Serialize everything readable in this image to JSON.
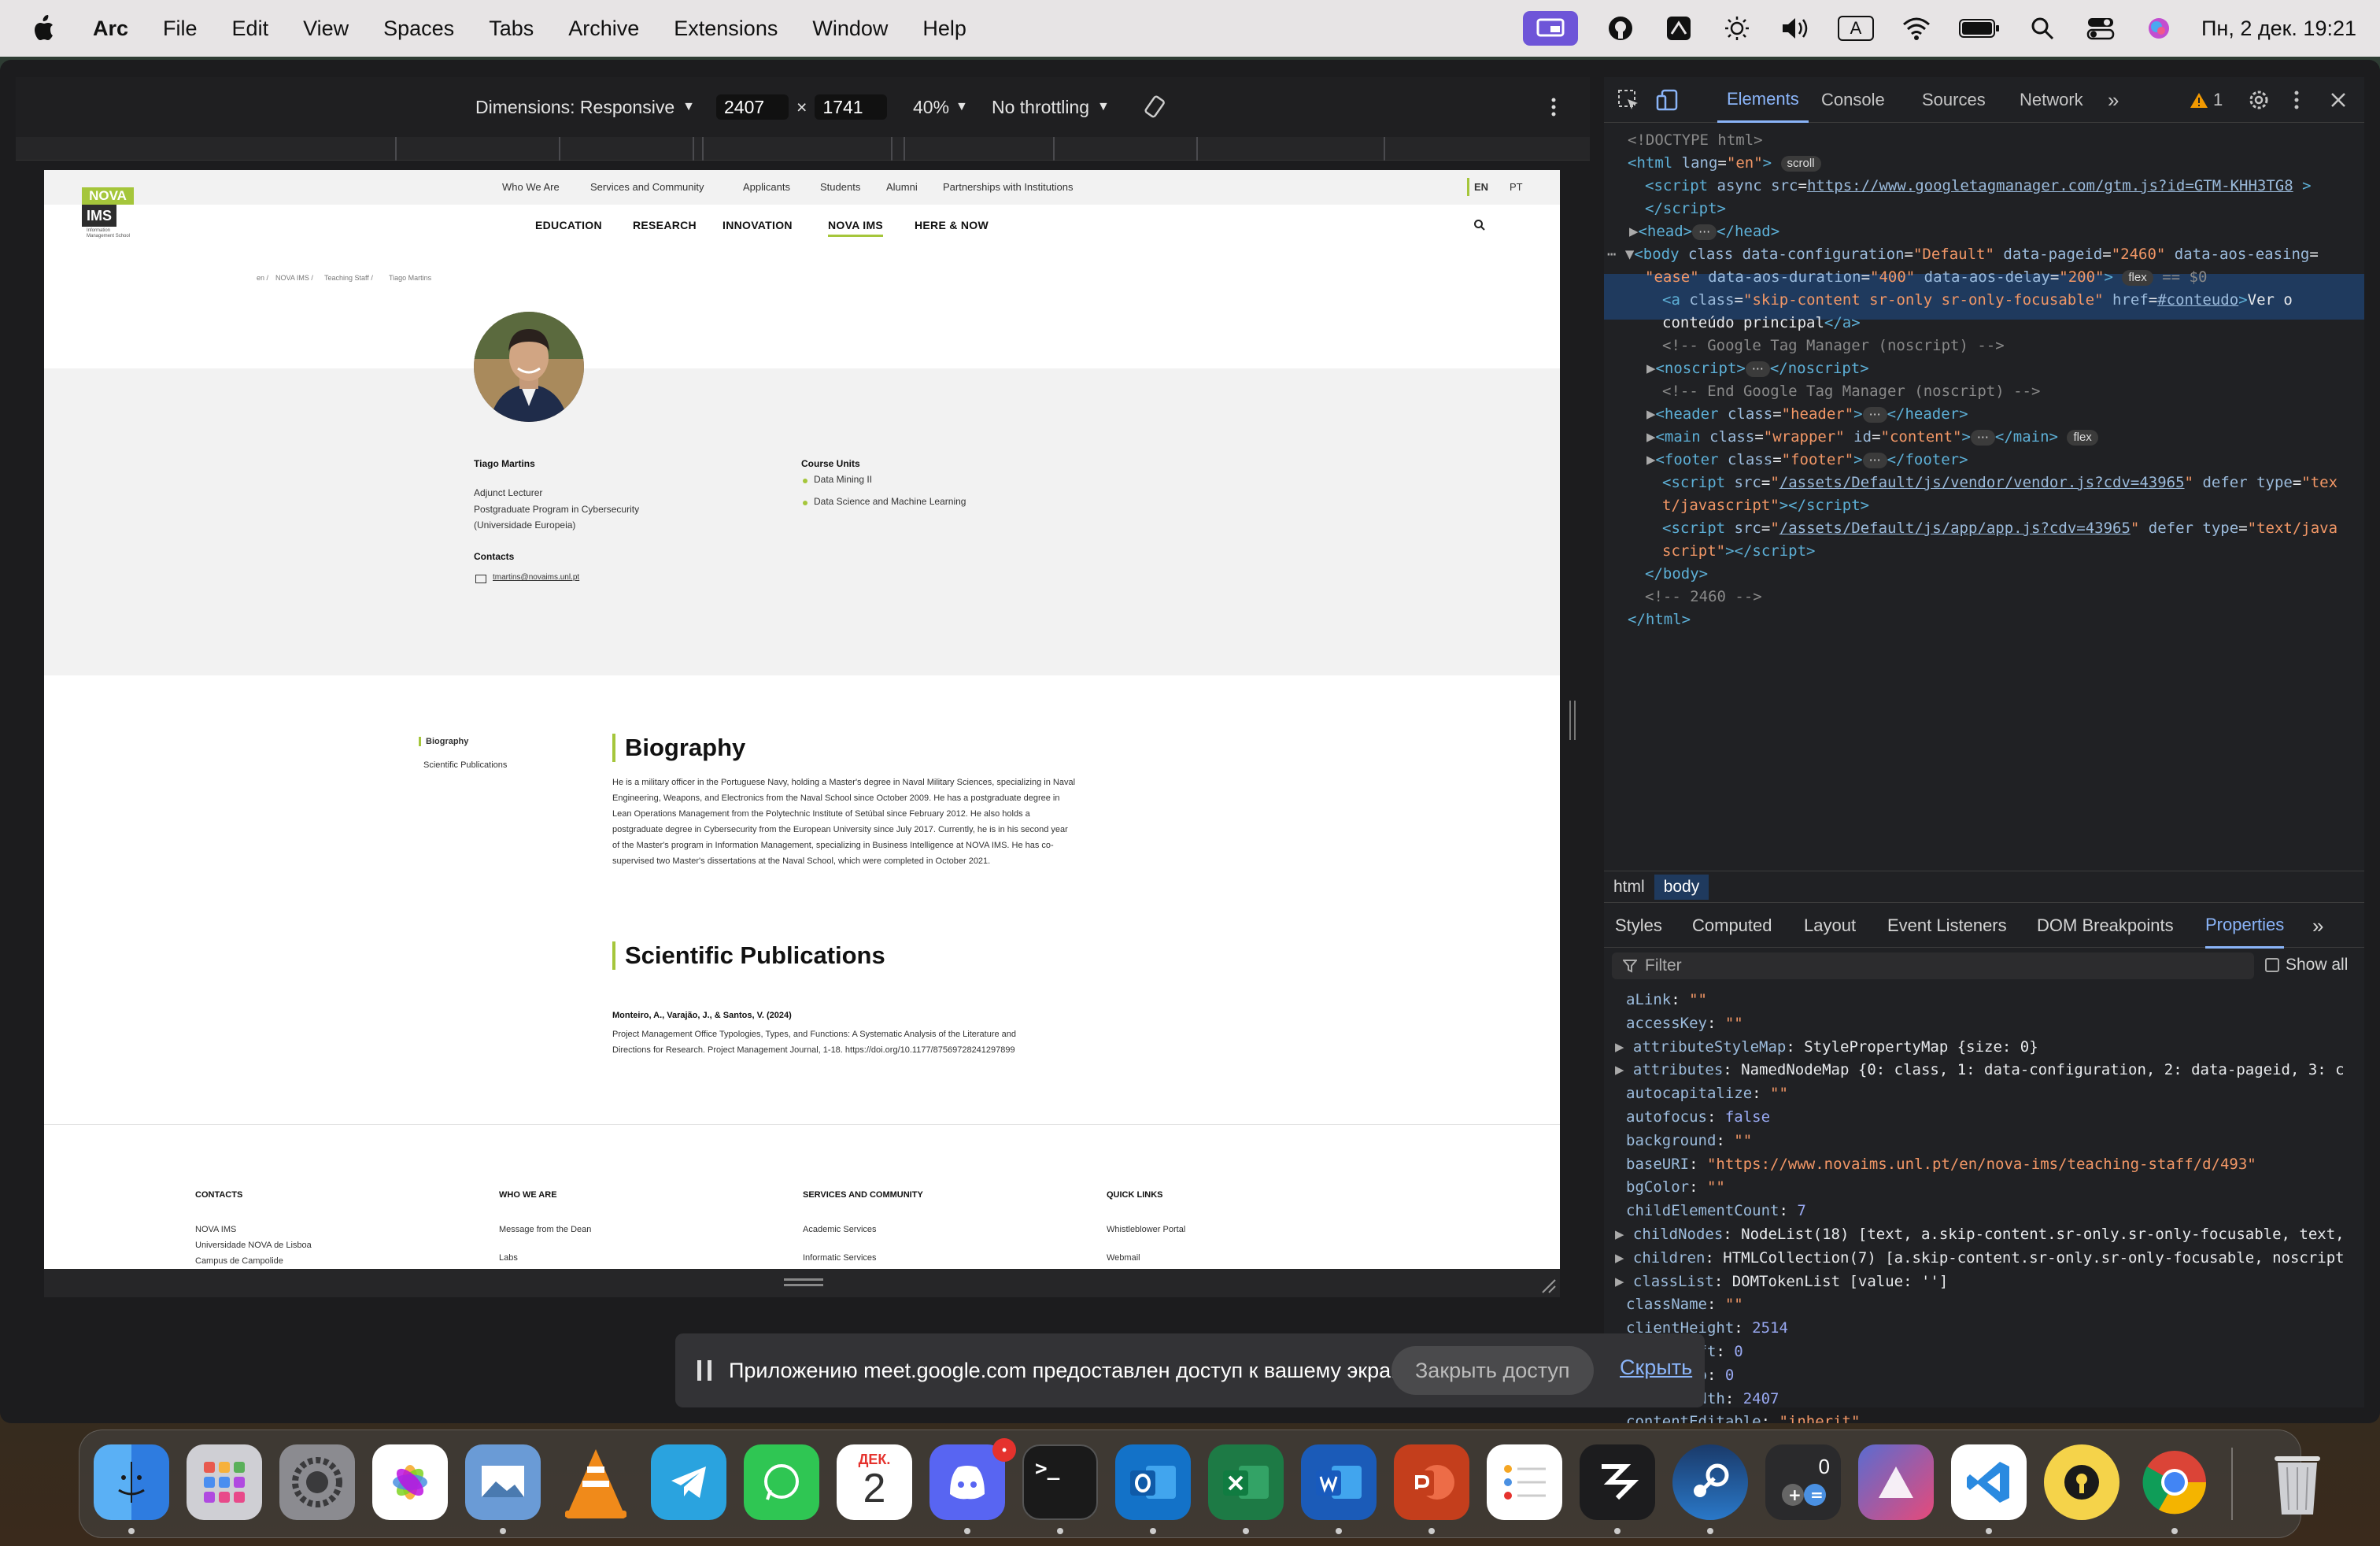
{
  "menubar": {
    "app": "Arc",
    "items": [
      "File",
      "Edit",
      "View",
      "Spaces",
      "Tabs",
      "Archive",
      "Extensions",
      "Window",
      "Help"
    ],
    "clock": "Пн, 2 дек.  19:21",
    "input_indicator": "A",
    "status_icons": [
      "screen-share-icon",
      "github-icon",
      "stage-icon",
      "brightness-icon",
      "volume-icon",
      "keyboard-icon",
      "wifi-icon",
      "battery-icon",
      "search-icon",
      "control-center-icon",
      "siri-icon"
    ]
  },
  "device_toolbar": {
    "dimensions_label": "Dimensions: Responsive",
    "width": "2407",
    "times": "×",
    "height": "1741",
    "zoom": "40%",
    "throttling": "No throttling"
  },
  "site": {
    "logo": {
      "nova": "NOVA",
      "ims": "IMS",
      "sub": "Information Management School"
    },
    "top_nav": [
      "Who We Are",
      "Services and Community",
      "Applicants",
      "Students",
      "Alumni",
      "Partnerships with Institutions"
    ],
    "langs": [
      "EN",
      "PT"
    ],
    "main_nav": [
      "EDUCATION",
      "RESEARCH",
      "INNOVATION",
      "NOVA IMS",
      "HERE & NOW"
    ],
    "breadcrumb": [
      "en /",
      "NOVA IMS /",
      "Teaching Staff /",
      "Tiago Martins"
    ],
    "profile": {
      "name": "Tiago Martins",
      "role": "Adjunct Lecturer",
      "program_line1": "Postgraduate Program in Cybersecurity",
      "program_line2": "(Universidade Europeia)",
      "contacts_label": "Contacts",
      "email": "tmartins@novaims.unl.pt",
      "course_units_label": "Course Units",
      "course_units": [
        "Data Mining II",
        "Data Science and Machine Learning"
      ]
    },
    "side_nav": [
      "Biography",
      "Scientific Publications"
    ],
    "biography": {
      "title": "Biography",
      "lines": [
        "He is a military officer in the Portuguese Navy, holding a Master's degree in Naval Military Sciences, specializing in Naval",
        "Engineering, Weapons, and Electronics from the Naval School since October 2009. He has a postgraduate degree in",
        "Lean Operations Management from the Polytechnic Institute of Setúbal since February 2012. He also holds a",
        "postgraduate degree in Cybersecurity from the European University since July 2017. Currently, he is in his second year",
        "of the Master's program in Information Management, specializing in Business Intelligence at NOVA IMS. He has co-",
        "supervised two Master's dissertations at the Naval School, which were completed in October 2021."
      ]
    },
    "publications": {
      "title": "Scientific Publications",
      "authors": "Monteiro, A., Varajão, J., & Santos, V. (2024)",
      "line1": "Project Management Office Typologies, Types, and Functions: A Systematic Analysis of the Literature and",
      "line2": "Directions for Research. Project Management Journal, 1-18. https://doi.org/10.1177/87569728241297899"
    },
    "footer": {
      "contacts": {
        "title": "CONTACTS",
        "items": [
          "NOVA IMS",
          "Universidade NOVA de Lisboa",
          "Campus de Campolide"
        ]
      },
      "who_we_are": {
        "title": "WHO WE ARE",
        "items": [
          "Message from the Dean",
          "Labs"
        ]
      },
      "services": {
        "title": "SERVICES AND COMMUNITY",
        "items": [
          "Academic Services",
          "Informatic Services"
        ]
      },
      "quick_links": {
        "title": "QUICK LINKS",
        "items": [
          "Whistleblower Portal",
          "Webmail"
        ]
      }
    }
  },
  "devtools": {
    "tabs": [
      "Elements",
      "Console",
      "Sources",
      "Network"
    ],
    "more": "»",
    "warnings": "1",
    "dom": {
      "l1": "<!DOCTYPE html>",
      "l3_src": "https://www.googletagmanager.com/gtm.js?id=GTM-KHH3TG8",
      "l6a": "\"Default\"",
      "l6b": "\"2460\"",
      "l6c": "\"ease\"",
      "l6d": "\"400\"",
      "l6e": "\"200\"",
      "l6_eq": "== $0",
      "l7_href": "#conteudo",
      "l7_text1": "Ver o",
      "l7_text2": "conteúdo principal",
      "c1": "<!-- Google Tag Manager (noscript) -->",
      "c2": "<!-- End Google Tag Manager (noscript) -->",
      "vendor": "/assets/Default/js/vendor/vendor.js?cdv=43965",
      "appjs": "/assets/Default/js/app/app.js?cdv=43965",
      "c3": "<!-- 2460 -->",
      "pill_scroll": "scroll",
      "pill_flex": "flex"
    },
    "breadcrumbs": [
      "html",
      "body"
    ],
    "subtabs": [
      "Styles",
      "Computed",
      "Layout",
      "Event Listeners",
      "DOM Breakpoints",
      "Properties"
    ],
    "filter_placeholder": "Filter",
    "show_all": "Show all",
    "properties": [
      {
        "k": "aLink",
        "v": "\"\""
      },
      {
        "k": "accessKey",
        "v": "\"\""
      },
      {
        "k": "attributeStyleMap",
        "v": "StylePropertyMap {size: 0}"
      },
      {
        "k": "attributes",
        "v": "NamedNodeMap {0: class, 1: data-configuration, 2: data-pageid, 3: c"
      },
      {
        "k": "autocapitalize",
        "v": "\"\""
      },
      {
        "k": "autofocus",
        "v": "false"
      },
      {
        "k": "background",
        "v": "\"\""
      },
      {
        "k": "baseURI",
        "v": "\"https://www.novaims.unl.pt/en/nova-ims/teaching-staff/d/493\""
      },
      {
        "k": "bgColor",
        "v": "\"\""
      },
      {
        "k": "childElementCount",
        "v": "7"
      },
      {
        "k": "childNodes",
        "v": "NodeList(18) [text, a.skip-content.sr-only.sr-only-focusable, text,"
      },
      {
        "k": "children",
        "v": "HTMLCollection(7) [a.skip-content.sr-only.sr-only-focusable, noscript"
      },
      {
        "k": "classList",
        "v": "DOMTokenList [value: '']"
      },
      {
        "k": "className",
        "v": "\"\""
      },
      {
        "k": "clientHeight",
        "v": "2514"
      },
      {
        "k": "clientLeft",
        "v": "0"
      },
      {
        "k": "clientTop",
        "v": "0"
      },
      {
        "k": "clientWidth",
        "v": "2407"
      },
      {
        "k": "contentEditable",
        "v": "\"inherit\""
      }
    ]
  },
  "share_bar": {
    "message": "Приложению meet.google.com предоставлен доступ к вашему экрану.",
    "stop": "Закрыть доступ",
    "hide": "Скрыть"
  },
  "dock": {
    "calendar_month": "ДЕК.",
    "calendar_day": "2",
    "discord_badge": "•",
    "calculator_display": "0",
    "apps": [
      "finder-icon",
      "launchpad-icon",
      "system-settings-icon",
      "photos-icon",
      "preview-icon",
      "vlc-icon",
      "telegram-icon",
      "whatsapp-icon",
      "calendar-icon",
      "discord-icon",
      "terminal-icon",
      "outlook-icon",
      "excel-icon",
      "word-icon",
      "powerpoint-icon",
      "reminders-icon",
      "stage-icon",
      "steam-icon",
      "calculator-icon",
      "affinity-icon",
      "vscode-icon",
      "keeper-icon",
      "chrome-icon",
      "trash-icon"
    ]
  },
  "colors": {
    "accent_green": "#a5c63b",
    "devtools_blue": "#8ab4f8",
    "menubar_bg": "#e7e4e5"
  }
}
